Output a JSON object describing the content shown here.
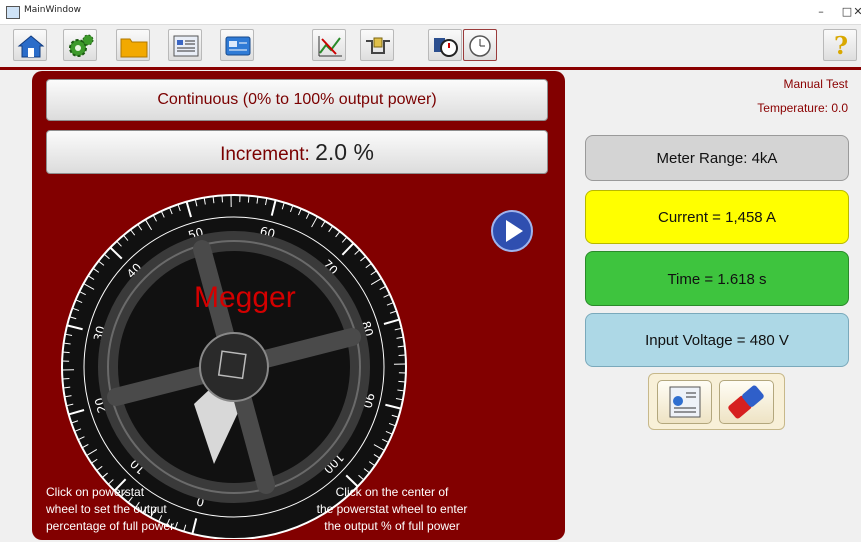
{
  "window": {
    "title": "MainWindow",
    "minimize": "–",
    "maximize": "□",
    "close": "✕"
  },
  "toolbar": {
    "items": [
      "home-icon",
      "settings-icon",
      "folder-icon",
      "report-icon",
      "card-icon",
      "chart-icon",
      "relay-icon",
      "timer-start-icon",
      "clock-icon"
    ],
    "help": "?"
  },
  "panel": {
    "mode_label": "Continuous  (0% to 100% output power)",
    "increment_label": "Increment:",
    "increment_value": "2.0 %",
    "dial_brand": "Megger",
    "dial_ticks": [
      "0",
      "10",
      "20",
      "30",
      "40",
      "50",
      "60",
      "70",
      "80",
      "90",
      "100"
    ],
    "note_left": [
      "Click on powerstat",
      "wheel to set the output",
      "percentage of  full power"
    ],
    "note_right": [
      "Click on the center of",
      "the powerstat wheel to enter",
      "the output %  of full power"
    ]
  },
  "status": {
    "test_mode": "Manual Test",
    "temperature": "Temperature: 0.0",
    "meter_range": "Meter Range: 4kA",
    "current": "Current  = 1,458 A",
    "time": "Time = 1.618 s",
    "input_voltage": "Input Voltage = 480 V"
  },
  "colors": {
    "panel": "#820000",
    "current_bg": "#ffff00",
    "time_bg": "#3ec43e",
    "voltage_bg": "#add8e6",
    "meter_bg": "#d4d4d4",
    "play_button": "#2f4fb0"
  }
}
